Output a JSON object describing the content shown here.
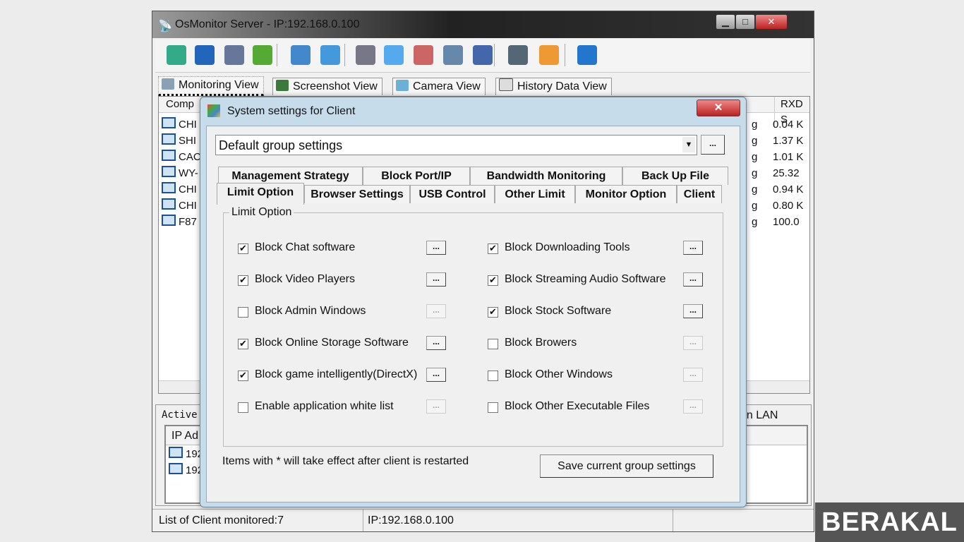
{
  "window": {
    "title": "OsMonitor Server -  IP:192.168.0.100",
    "minimize": "▁",
    "maximize": "□",
    "close": "✕"
  },
  "toolbar_icons": [
    "windows-icon",
    "globe-icon",
    "monitor-gear-icon",
    "users-icon",
    "network-icon",
    "usb-icon",
    "screen-icon",
    "email-icon",
    "document-icon",
    "windows-stack-icon",
    "disk-icon",
    "log-icon",
    "user-list-icon",
    "help-icon"
  ],
  "view_tabs": [
    "Monitoring View",
    "Screenshot View",
    "Camera View",
    "History Data View"
  ],
  "list": {
    "col_computer": "Comp",
    "col_rxd": "RXD S",
    "rows": [
      {
        "name": "CHI",
        "mid": "g",
        "rxd": "0.04 K"
      },
      {
        "name": "SHI",
        "mid": "g",
        "rxd": "1.37 K"
      },
      {
        "name": "CAC",
        "mid": "g",
        "rxd": "1.01 K"
      },
      {
        "name": "WY-",
        "mid": "g",
        "rxd": "25.32"
      },
      {
        "name": "CHI",
        "mid": "g",
        "rxd": "0.94 K"
      },
      {
        "name": "CHI",
        "mid": "g",
        "rxd": "0.80 K"
      },
      {
        "name": "F87",
        "mid": "g",
        "rxd": "100.0"
      }
    ]
  },
  "bottom": {
    "title": "Active",
    "right_label": "d in LAN",
    "col_ip": "IP Ad",
    "rows": [
      "192",
      "192"
    ]
  },
  "status": {
    "clients": "List of Client monitored:7",
    "ip": "IP:192.168.0.100"
  },
  "dialog": {
    "title": "System settings for Client",
    "close": "✕",
    "group_select": "Default group settings",
    "browse": "...",
    "tabs_row1": [
      "Management Strategy",
      "Block Port/IP",
      "Bandwidth Monitoring",
      "Back Up File"
    ],
    "tabs_row2": [
      "Limit Option",
      "Browser Settings",
      "USB Control",
      "Other Limit",
      "Monitor Option",
      "Client"
    ],
    "groupbox": "Limit Option",
    "options_left": [
      {
        "label": "Block Chat software",
        "checked": true
      },
      {
        "label": "Block Video Players",
        "checked": true
      },
      {
        "label": "Block Admin Windows",
        "checked": false
      },
      {
        "label": "Block Online Storage Software",
        "checked": true
      },
      {
        "label": "Block game intelligently(DirectX)",
        "checked": true
      },
      {
        "label": "Enable application white list",
        "checked": false
      }
    ],
    "options_right": [
      {
        "label": "Block Downloading Tools",
        "checked": true
      },
      {
        "label": "Block Streaming Audio Software",
        "checked": true
      },
      {
        "label": "Block Stock Software",
        "checked": true
      },
      {
        "label": "Block Browers",
        "checked": false
      },
      {
        "label": "Block Other Windows",
        "checked": false
      },
      {
        "label": "Block Other Executable Files",
        "checked": false
      }
    ],
    "dots": "...",
    "note": "Items with * will take effect after client is restarted",
    "save": "Save current group settings"
  },
  "watermark": "BERAKAL"
}
